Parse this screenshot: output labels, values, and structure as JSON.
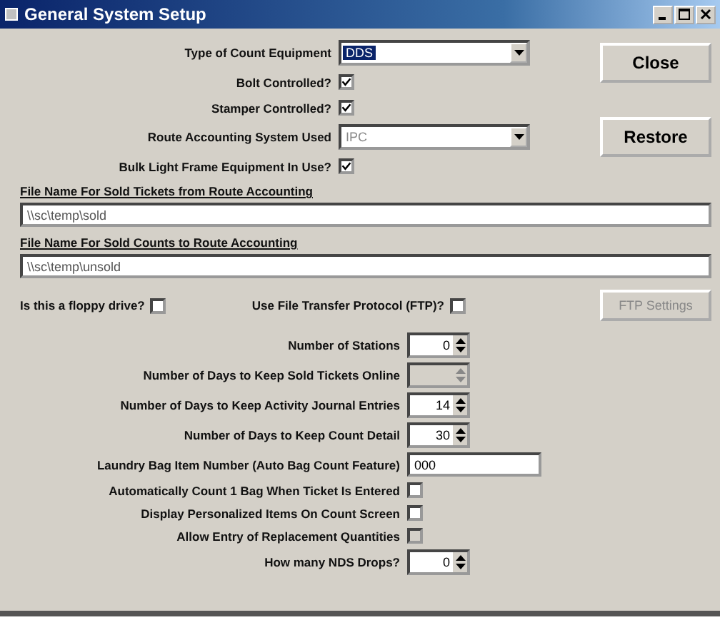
{
  "window": {
    "title": "General System Setup"
  },
  "equipment_settings": [
    {
      "kind": "select",
      "label": "Type of Count Equipment",
      "value": "DDS",
      "focused": true,
      "disabled": false
    },
    {
      "kind": "checkbox",
      "label": "Bolt Controlled?",
      "checked": true,
      "disabled": false
    },
    {
      "kind": "checkbox",
      "label": "Stamper Controlled?",
      "checked": true,
      "disabled": false
    },
    {
      "kind": "select",
      "label": "Route Accounting System Used",
      "value": "IPC",
      "focused": false,
      "disabled": true
    },
    {
      "kind": "checkbox",
      "label": "Bulk Light Frame Equipment In Use?",
      "checked": true,
      "disabled": false
    }
  ],
  "buttons": [
    {
      "label": "Close"
    },
    {
      "label": "Restore"
    }
  ],
  "file_fields": [
    {
      "label": "File Name For Sold Tickets from Route Accounting",
      "value": "\\\\sc\\temp\\sold"
    },
    {
      "label": "File Name For Sold Counts to Route Accounting",
      "value": "\\\\sc\\temp\\unsold"
    }
  ],
  "transfer_options": [
    {
      "label": "Is this a floppy drive?",
      "checked": false
    },
    {
      "label": "Use File Transfer Protocol (FTP)?",
      "checked": false
    }
  ],
  "ftp_settings_button": {
    "label": "FTP Settings",
    "disabled": true
  },
  "retention_settings": [
    {
      "kind": "spin",
      "label": "Number of Stations",
      "value": "0",
      "disabled": false
    },
    {
      "kind": "spin",
      "label": "Number of Days to Keep Sold Tickets Online",
      "disabled": true
    },
    {
      "kind": "spin",
      "label": "Number of Days to Keep Activity Journal Entries",
      "value": "14",
      "disabled": false
    },
    {
      "kind": "spin",
      "label": "Number of Days to Keep Count Detail",
      "value": "30",
      "disabled": false
    },
    {
      "kind": "text",
      "label": "Laundry Bag Item Number (Auto Bag Count Feature)",
      "value": "000"
    },
    {
      "kind": "checkbox",
      "label": "Automatically Count 1 Bag When Ticket Is Entered",
      "checked": false,
      "disabled": false
    },
    {
      "kind": "checkbox",
      "label": "Display Personalized Items On Count Screen",
      "checked": false,
      "disabled": false
    },
    {
      "kind": "checkbox",
      "label": "Allow Entry of Replacement Quantities",
      "checked": false,
      "disabled": true
    },
    {
      "kind": "spin",
      "label": "How many NDS Drops?",
      "value": "0",
      "disabled": false
    }
  ]
}
